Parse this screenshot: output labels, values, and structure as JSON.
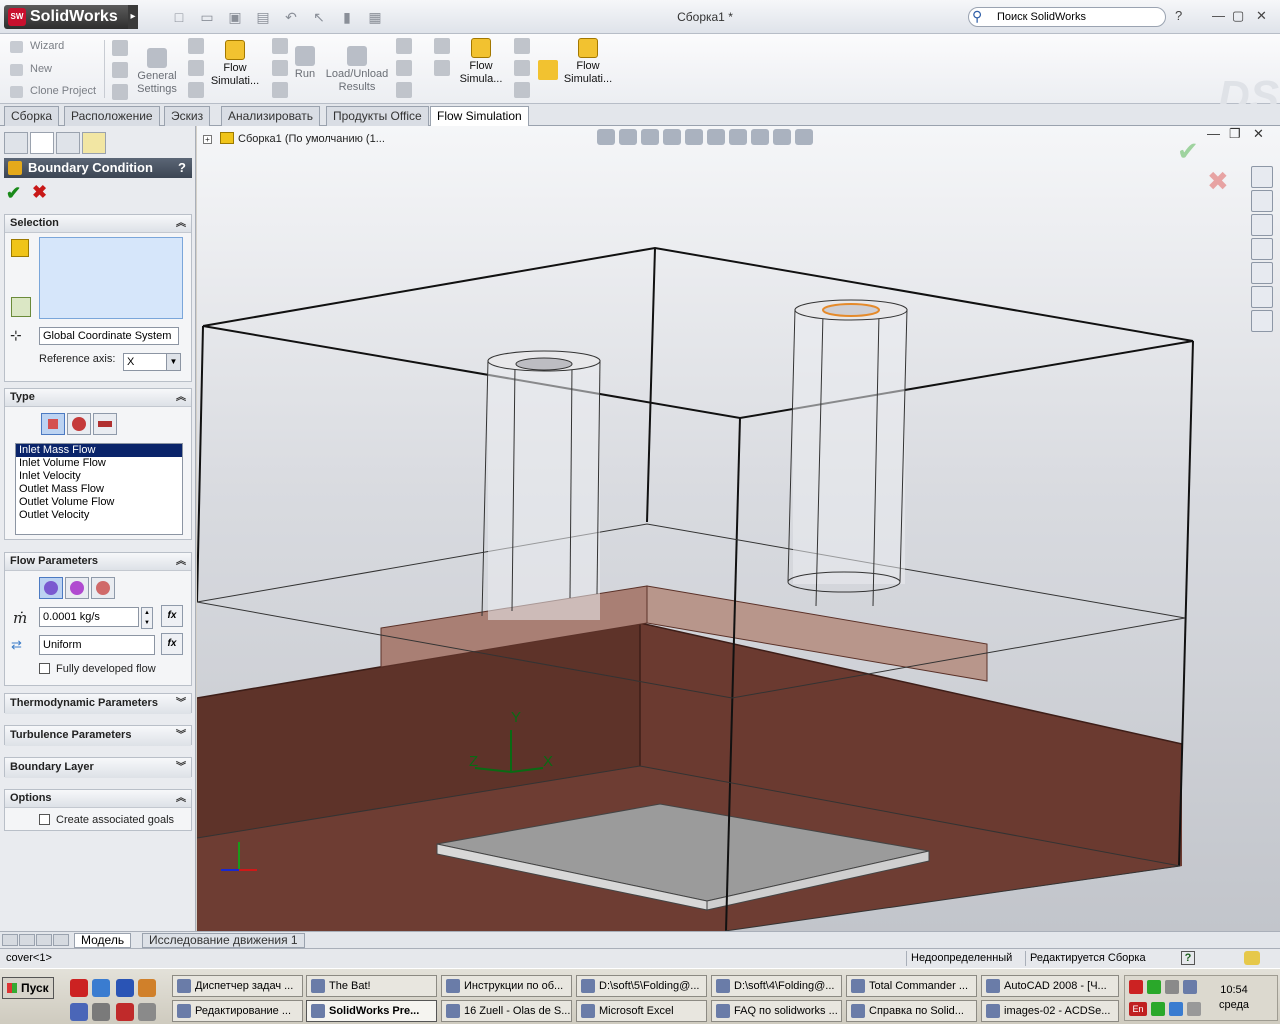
{
  "app": {
    "name": "SolidWorks",
    "logo_badge": "SW",
    "doc_title": "Сборка1 *",
    "search_placeholder": "Поиск SolidWorks"
  },
  "command_manager": {
    "small": [
      "Wizard",
      "New",
      "Clone Project"
    ],
    "buttons": [
      {
        "l1": "General",
        "l2": "Settings"
      },
      {
        "l1": "Flow",
        "l2": "Simulati..."
      },
      {
        "l1": "Run",
        "l2": ""
      },
      {
        "l1": "Load/Unload",
        "l2": "Results"
      },
      {
        "l1": "Flow",
        "l2": "Simula..."
      },
      {
        "l1": "Flow",
        "l2": "Simulati..."
      }
    ]
  },
  "tabs": [
    "Сборка",
    "Расположение",
    "Эскиз",
    "Анализировать",
    "Продукты Office",
    "Flow Simulation"
  ],
  "active_tab": "Flow Simulation",
  "property_manager": {
    "title": "Boundary Condition",
    "help": "?",
    "selection": {
      "header": "Selection",
      "coord_system": "Global Coordinate System",
      "ref_axis_label": "Reference axis:",
      "ref_axis_value": "X"
    },
    "type": {
      "header": "Type",
      "options": [
        "Inlet Mass Flow",
        "Inlet Volume Flow",
        "Inlet Velocity",
        "Outlet Mass Flow",
        "Outlet Volume Flow",
        "Outlet Velocity"
      ],
      "selected": "Inlet Mass Flow"
    },
    "flow_parameters": {
      "header": "Flow Parameters",
      "mdot_symbol": "ṁ",
      "mass_flow": "0.0001 kg/s",
      "profile": "Uniform",
      "fully_developed_label": "Fully developed flow",
      "fully_developed_checked": false,
      "fx_label": "fx"
    },
    "collapsed": [
      "Thermodynamic Parameters",
      "Turbulence Parameters",
      "Boundary Layer"
    ],
    "options": {
      "header": "Options",
      "goals_label": "Create associated goals",
      "goals_checked": false
    }
  },
  "feature_tree": {
    "label": "Сборка1  (По умолчанию (1..."
  },
  "triad": {
    "x": "X",
    "y": "Y",
    "z": "Z"
  },
  "bottom_tabs": [
    "Модель",
    "Исследование движения 1"
  ],
  "status": {
    "left": "cover<1>",
    "state1": "Недоопределенный",
    "state2": "Редактируется Сборка",
    "help": "?"
  },
  "taskbar": {
    "start": "Пуск",
    "row1": [
      "Диспетчер задач ...",
      "The Bat!",
      "Инструкции по об...",
      "D:\\soft\\5\\Folding@...",
      "D:\\soft\\4\\Folding@...",
      "Total Commander ...",
      "AutoCAD 2008 - [Ч..."
    ],
    "row2": [
      "Редактирование ...",
      "SolidWorks Pre...",
      "16 Zuell - Olas de S...",
      "Microsoft Excel",
      "FAQ по solidworks ...",
      "Справка по Solid...",
      "images-02 - ACDSe..."
    ],
    "pressed": "SolidWorks Pre...",
    "clock_time": "10:54",
    "clock_day": "среда",
    "lang": "En"
  },
  "colors": {
    "brand": "#c8102e",
    "title_bar": "#3c4553",
    "selection": "#0a246a",
    "plate": "#6b3a30",
    "fins": "#a97f74"
  }
}
